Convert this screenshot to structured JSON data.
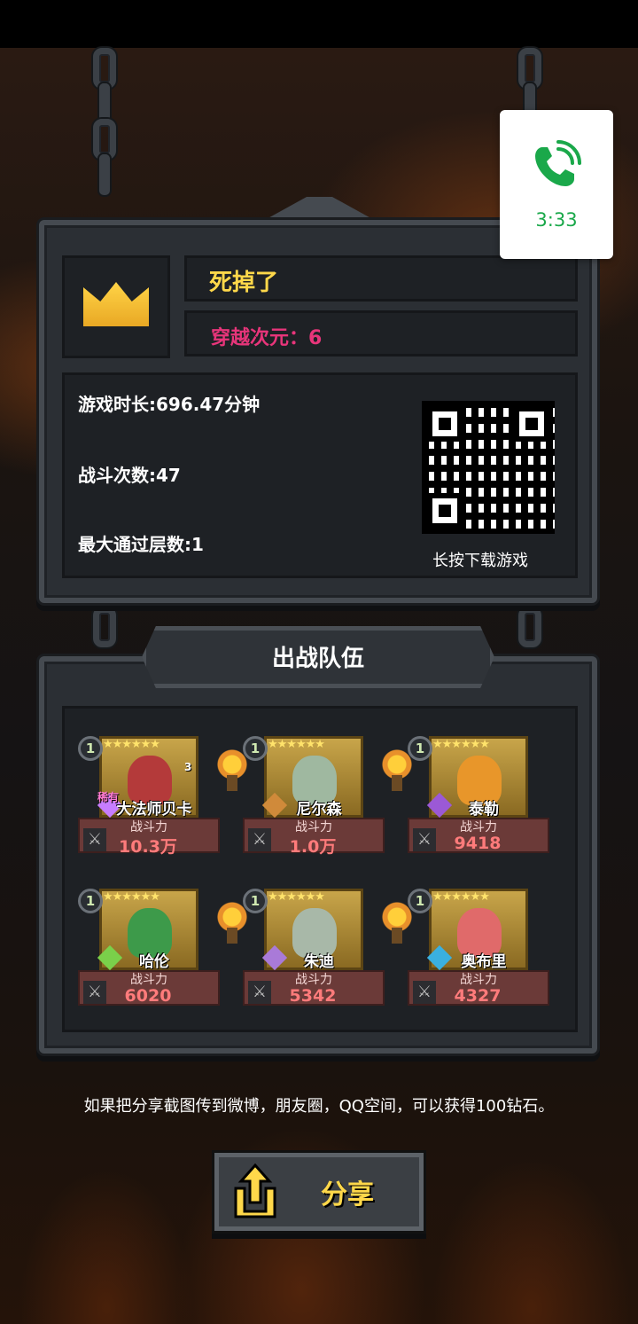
{
  "result": {
    "title": "死掉了",
    "rift": "穿越次元：6"
  },
  "stats": {
    "play_time": "游戏时长:696.47分钟",
    "battles": "战斗次数:47",
    "max_floor": "最大通过层数:1",
    "qr_caption": "长按下载游戏"
  },
  "team": {
    "title": "出战队伍",
    "power_label": "战斗力",
    "heroes": [
      {
        "name": "大法师贝卡",
        "level": "1",
        "power": "10.3万",
        "rare": "稀有",
        "badge": "3",
        "color": "#b43a3a",
        "icon_color": "#c77dff"
      },
      {
        "name": "尼尔森",
        "level": "1",
        "power": "1.0万",
        "color": "#9fb8a0",
        "icon_color": "#d08a3a"
      },
      {
        "name": "泰勒",
        "level": "1",
        "power": "9418",
        "color": "#e8962a",
        "icon_color": "#9b59d6"
      },
      {
        "name": "哈伦",
        "level": "1",
        "power": "6020",
        "color": "#3d9a4a",
        "icon_color": "#7ad04a"
      },
      {
        "name": "朱迪",
        "level": "1",
        "power": "5342",
        "color": "#a8b8a8",
        "icon_color": "#a97ad8"
      },
      {
        "name": "奥布里",
        "level": "1",
        "power": "4327",
        "color": "#e06a6a",
        "icon_color": "#3ab0e0"
      }
    ]
  },
  "hint": "如果把分享截图传到微博，朋友圈，QQ空间，可以获得100钻石。",
  "share": {
    "label": "分享"
  },
  "call": {
    "time": "3:33",
    "color": "#1aa84a"
  },
  "colors": {
    "gold": "#ffd84a",
    "rift_pink": "#e7357a",
    "power_red": "#ff7b7b"
  }
}
